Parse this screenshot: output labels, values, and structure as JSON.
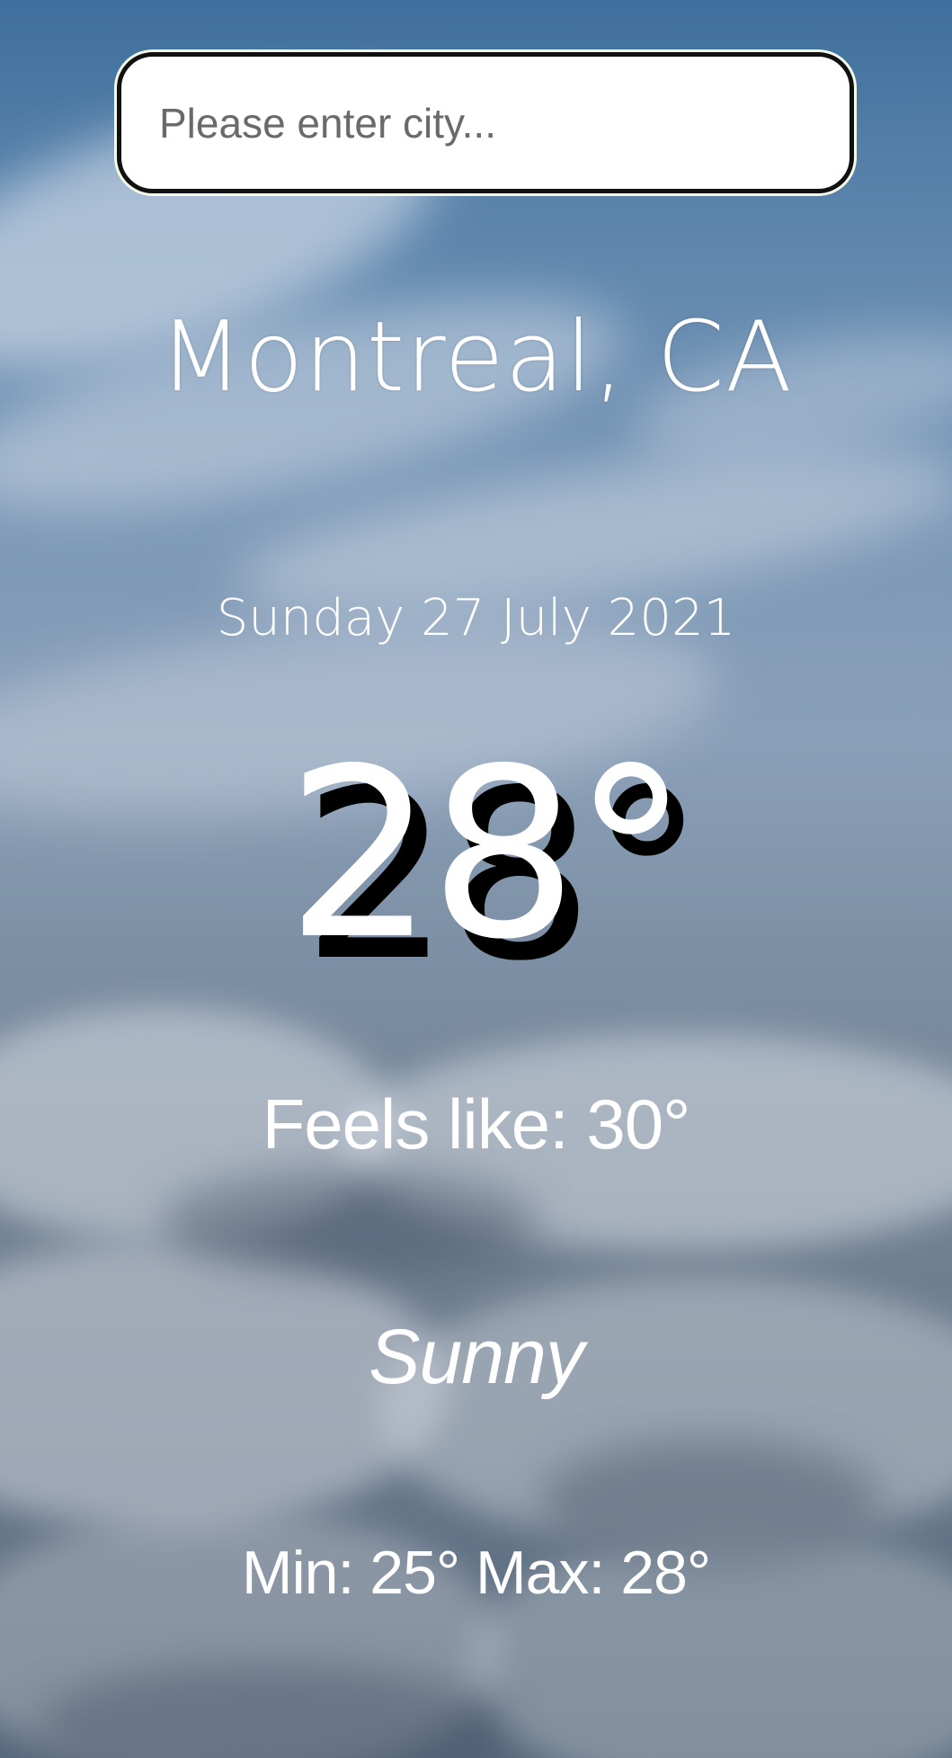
{
  "search": {
    "placeholder": "Please enter city...",
    "value": ""
  },
  "weather": {
    "location": "Montreal, CA",
    "date": "Sunday 27 July 2021",
    "temperature": "28°",
    "feels_like": "Feels like: 30°",
    "condition": "Sunny",
    "min_max": "Min: 25° Max: 28°"
  },
  "colors": {
    "text": "#ffffff",
    "temperature_shadow": "#000000",
    "search_border": "#111111",
    "search_background": "#ffffff",
    "sky_top": "#3f6f9d",
    "sky_bottom": "#55677b"
  }
}
